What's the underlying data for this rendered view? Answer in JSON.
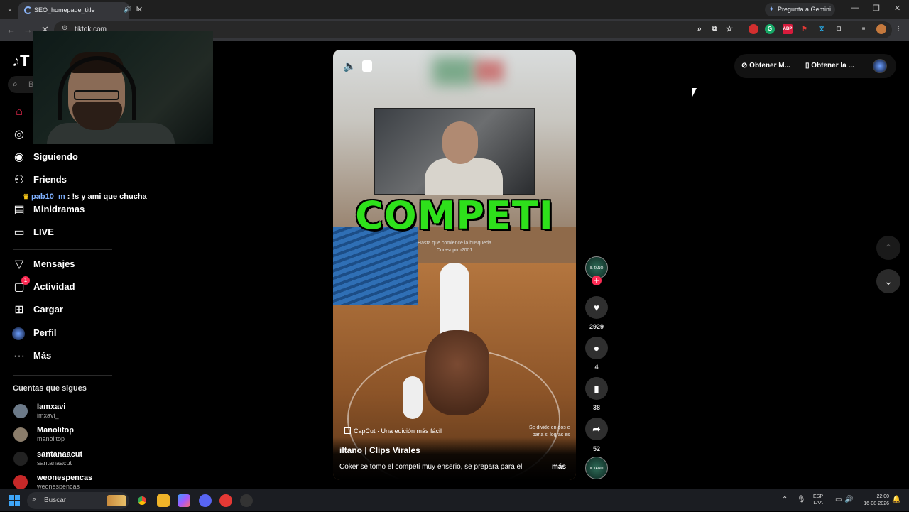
{
  "browser": {
    "tab_title": "SEO_homepage_title",
    "new_tab_symbol": "+",
    "gemini_button": "Pregunta a Gemini",
    "url": "tiktok.com"
  },
  "sidebar": {
    "search_placeholder": "B",
    "nav": [
      {
        "label": "Siguiendo"
      },
      {
        "label": "Friends"
      },
      {
        "label": "Minidramas"
      },
      {
        "label": "LIVE"
      },
      {
        "label": "Mensajes"
      },
      {
        "label": "Actividad",
        "badge": "1"
      },
      {
        "label": "Cargar"
      },
      {
        "label": "Perfil"
      },
      {
        "label": "Más"
      }
    ],
    "following_title": "Cuentas que sigues",
    "accounts": [
      {
        "name": "Iamxavi",
        "handle": "imxavi_"
      },
      {
        "name": "Manolitop",
        "handle": "manolitop"
      },
      {
        "name": "santanaacut",
        "handle": "santanaacut"
      },
      {
        "name": "weonespencas",
        "handle": "weonespencas"
      }
    ]
  },
  "chat": {
    "user": "pab10_m",
    "message": ": !s y ami que chucha"
  },
  "video": {
    "headline": "COMPETI",
    "subcaption_1": "Hasta que comience la búsqueda",
    "subcaption_2": "Corasoprro2001",
    "capcut": "CapCut · Una edición más fácil",
    "side_caption_1": "Se divide en dos e",
    "side_caption_2": "bana si logras es",
    "author": "iltano | Clips Virales",
    "description": "Coker se tomo el competi muy enserio, se prepara para el",
    "more": "más"
  },
  "actions": {
    "likes": "2929",
    "comments": "4",
    "saves": "38",
    "shares": "52"
  },
  "top_right": {
    "obtain_1": "Obtener M...",
    "obtain_2": "Obtener la ..."
  },
  "taskbar": {
    "search": "Buscar",
    "lang_1": "ESP",
    "lang_2": "LAA",
    "time": "22:00",
    "date": "16-08-2026"
  }
}
